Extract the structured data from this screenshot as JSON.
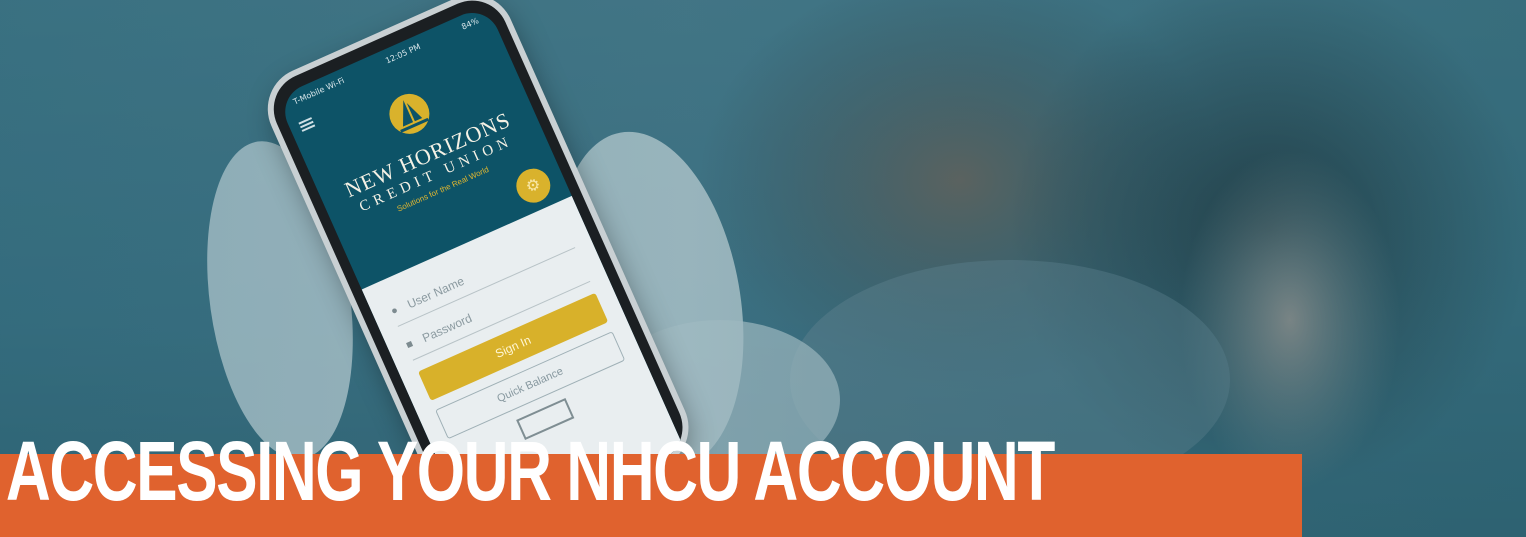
{
  "hero": {
    "title": "ACCESSING YOUR NHCU ACCOUNT"
  },
  "phone": {
    "status": {
      "carrier": "T-Mobile Wi-Fi",
      "time": "12:05 PM",
      "battery": "84%"
    },
    "app": {
      "brand_line1": "NEW HORIZONS",
      "brand_line2": "CREDIT UNION",
      "tagline": "Solutions for the Real World",
      "username_placeholder": "User Name",
      "password_placeholder": "Password",
      "signin_label": "Sign In",
      "quick_balance_label": "Quick Balance"
    }
  },
  "colors": {
    "accent": "#e0622e",
    "teal": "#0d5367",
    "gold": "#d8b12a"
  }
}
